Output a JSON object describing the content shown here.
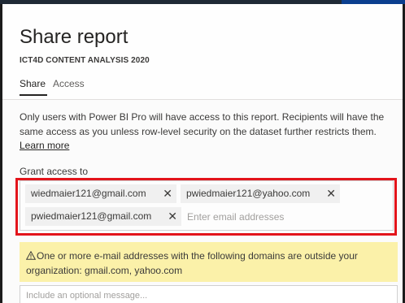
{
  "dialog": {
    "title": "Share report",
    "subtitle": "ICT4D CONTENT ANALYSIS 2020"
  },
  "tabs": [
    {
      "label": "Share",
      "active": true
    },
    {
      "label": "Access",
      "active": false
    }
  ],
  "info": {
    "text": "Only users with Power BI Pro will have access to this report. Recipients will have the same access as you unless row-level security on the dataset further restricts them.",
    "link": "Learn more"
  },
  "grant": {
    "label": "Grant access to",
    "recipients": [
      {
        "email": "wiedmaier121@gmail.com",
        "remove_glyph": "✕"
      },
      {
        "email": "pwiedmaier121@yahoo.com",
        "remove_glyph": "✕"
      },
      {
        "email": "pwiedmaier121@gmail.com",
        "remove_glyph": "✕"
      }
    ],
    "input_placeholder": "Enter email addresses"
  },
  "warning": {
    "icon": "warning-triangle-icon",
    "text": "One or more e-mail addresses with the following domains are outside your organization: gmail.com, yahoo.com"
  },
  "message": {
    "placeholder": "Include an optional message..."
  },
  "colors": {
    "annotation_border": "#e3141b",
    "warning_background": "#fbf1a9",
    "chip_background": "#f0f0f0"
  }
}
